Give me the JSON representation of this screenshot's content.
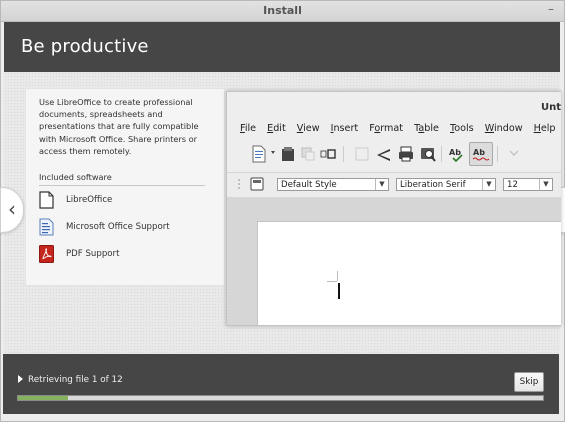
{
  "window": {
    "title": "Install",
    "minimize_glyph": "–"
  },
  "header": {
    "heading": "Be productive"
  },
  "nav": {
    "prev_glyph": "‹",
    "next_glyph": "›"
  },
  "info": {
    "description": "Use LibreOffice to create professional documents, spreadsheets and presentations that are fully compatible with Microsoft Office. Share printers or access them remotely.",
    "included_label": "Included software",
    "software": [
      {
        "label": "LibreOffice",
        "icon": "document-icon"
      },
      {
        "label": "Microsoft Office Support",
        "icon": "office-doc-icon"
      },
      {
        "label": "PDF Support",
        "icon": "pdf-icon"
      }
    ]
  },
  "screenshot": {
    "title_fragment": "Unt",
    "menu": [
      "File",
      "Edit",
      "View",
      "Insert",
      "Format",
      "Table",
      "Tools",
      "Window",
      "Help"
    ],
    "menu_underline": [
      "F",
      "E",
      "V",
      "I",
      "o",
      "a",
      "T",
      "W",
      "H"
    ],
    "style_combo": "Default Style",
    "font_combo": "Liberation Serif",
    "size_combo": "12",
    "combo_arrow": "▼"
  },
  "footer": {
    "status_text": "Retrieving file 1 of 12",
    "skip_label": "Skip",
    "progress_fraction": 0.095,
    "progress_color": "#86b25f"
  }
}
